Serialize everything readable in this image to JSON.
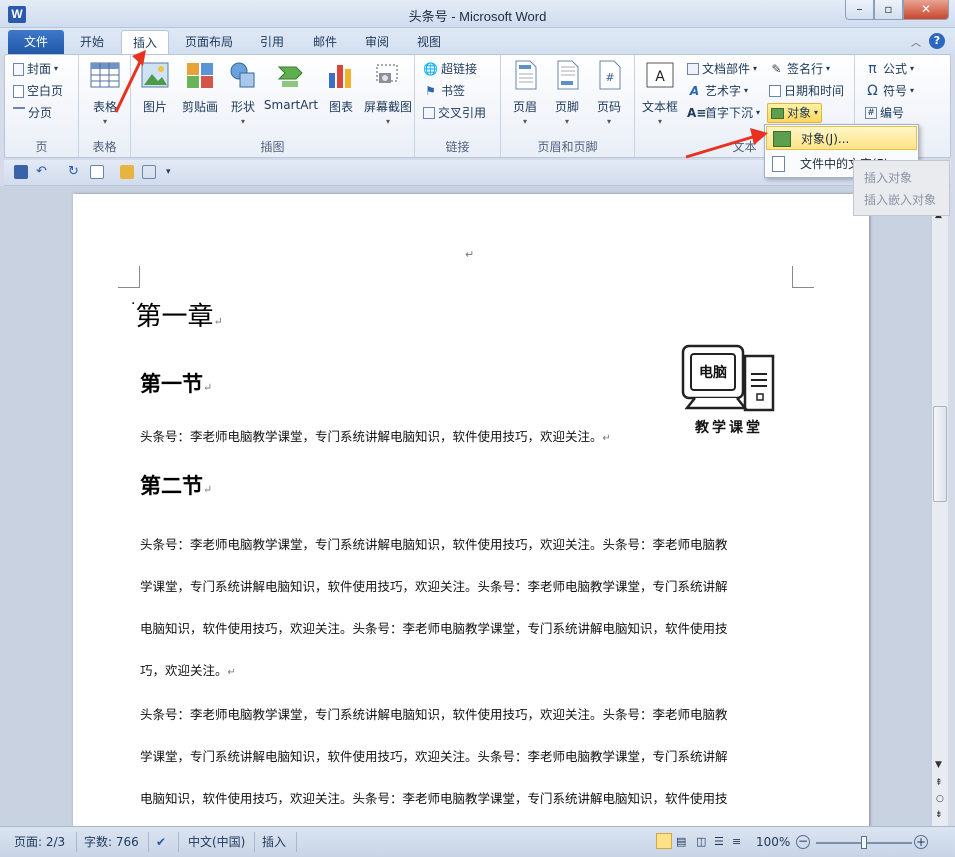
{
  "window": {
    "title": "头条号 - Microsoft Word",
    "app_icon": "W"
  },
  "tabs": {
    "file": "文件",
    "items": [
      "开始",
      "插入",
      "页面布局",
      "引用",
      "邮件",
      "审阅",
      "视图"
    ],
    "active": "插入"
  },
  "ribbon": {
    "page": {
      "label": "页",
      "cover": "封面",
      "blank": "空白页",
      "break": "分页"
    },
    "table": {
      "label": "表格",
      "table": "表格"
    },
    "illustrations": {
      "label": "插图",
      "picture": "图片",
      "clipart": "剪贴画",
      "shapes": "形状",
      "smartart": "SmartArt",
      "chart": "图表",
      "screenshot": "屏幕截图"
    },
    "links": {
      "label": "链接",
      "hyperlink": "超链接",
      "bookmark": "书签",
      "crossref": "交叉引用"
    },
    "header_footer": {
      "label": "页眉和页脚",
      "header": "页眉",
      "footer": "页脚",
      "page_number": "页码"
    },
    "text": {
      "label": "文本",
      "textbox": "文本框",
      "quickparts": "文档部件",
      "wordart": "艺术字",
      "dropcap": "首字下沉",
      "signature": "签名行",
      "datetime": "日期和时间",
      "object": "对象"
    },
    "symbols": {
      "pi": "π",
      "equation": "公式",
      "omega": "Ω",
      "symbol": "符号",
      "number": "编号"
    }
  },
  "object_menu": {
    "items": [
      "对象(J)...",
      "文件中的文字(F)..."
    ],
    "selected": "对象(J)..."
  },
  "tooltip": {
    "title": "插入对象",
    "desc": "插入嵌入对象"
  },
  "document": {
    "chapter": "第一章",
    "section1": "第一节",
    "para1": "头条号：李老师电脑教学课堂，专门系统讲解电脑知识，软件使用技巧，欢迎关注。",
    "section2": "第二节",
    "para2_lines": [
      "头条号：李老师电脑教学课堂，专门系统讲解电脑知识，软件使用技巧，欢迎关注。头条号：李老师电脑教",
      "学课堂，专门系统讲解电脑知识，软件使用技巧，欢迎关注。头条号：李老师电脑教学课堂，专门系统讲解",
      "电脑知识，软件使用技巧，欢迎关注。头条号：李老师电脑教学课堂，专门系统讲解电脑知识，软件使用技",
      "巧，欢迎关注。"
    ],
    "para3_lines": [
      "头条号：李老师电脑教学课堂，专门系统讲解电脑知识，软件使用技巧，欢迎关注。头条号：李老师电脑教",
      "学课堂，专门系统讲解电脑知识，软件使用技巧，欢迎关注。头条号：李老师电脑教学课堂，专门系统讲解",
      "电脑知识，软件使用技巧，欢迎关注。头条号：李老师电脑教学课堂，专门系统讲解电脑知识，软件使用技"
    ],
    "logo_screen": "电脑",
    "logo_caption": "教学课堂",
    "para_mark": "↵"
  },
  "statusbar": {
    "page": "页面: 2/3",
    "words": "字数: 766",
    "language": "中文(中国)",
    "mode": "插入",
    "zoom": "100%",
    "zoom_level": 0.5
  },
  "colors": {
    "accent": "#2b579a",
    "file_tab": "#2a62b5",
    "highlight": "#ffe486",
    "arrow": "#e8321f"
  }
}
